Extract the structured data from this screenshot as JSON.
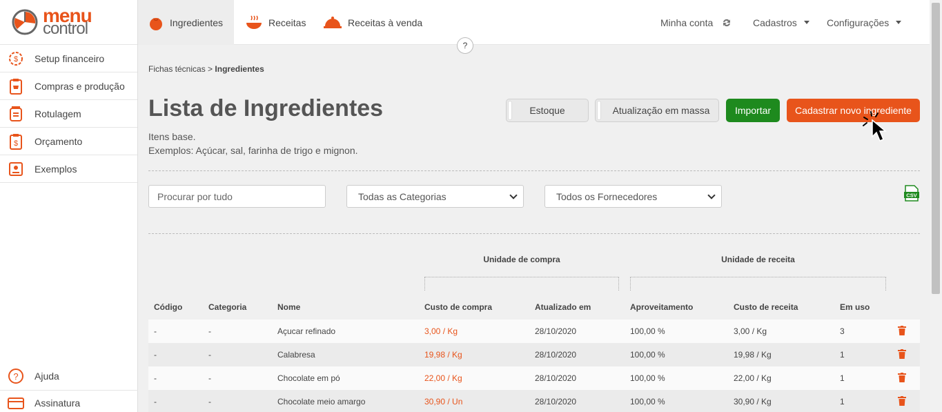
{
  "logo": {
    "line1": "menu",
    "line2": "control"
  },
  "sidebar": {
    "items": [
      {
        "label": "Setup financeiro",
        "icon": "gear-dollar-icon"
      },
      {
        "label": "Compras e produção",
        "icon": "cart-clipboard-icon"
      },
      {
        "label": "Rotulagem",
        "icon": "label-jar-icon"
      },
      {
        "label": "Orçamento",
        "icon": "dollar-clipboard-icon"
      },
      {
        "label": "Exemplos",
        "icon": "recipe-book-icon"
      }
    ],
    "bottom": [
      {
        "label": "Ajuda",
        "icon": "question-circle-icon"
      },
      {
        "label": "Assinatura",
        "icon": "credit-card-icon"
      }
    ]
  },
  "topnav": {
    "tabs": [
      {
        "label": "Ingredientes",
        "icon": "tomato-icon"
      },
      {
        "label": "Receitas",
        "icon": "steaming-bowl-icon"
      },
      {
        "label": "Receitas à venda",
        "icon": "cloche-icon"
      }
    ],
    "account": "Minha conta",
    "cadastros": "Cadastros",
    "configuracoes": "Configurações",
    "help": "?"
  },
  "breadcrumb": {
    "parent": "Fichas técnicas",
    "separator": ">",
    "current": "Ingredientes"
  },
  "page": {
    "title": "Lista de Ingredientes",
    "subtitle1": "Itens base.",
    "subtitle2": "Exemplos: Açúcar, sal, farinha de trigo e mignon."
  },
  "actions": {
    "estoque": "Estoque",
    "mass_update": "Atualização em massa",
    "import": "Importar",
    "new": "Cadastrar novo ingrediente"
  },
  "filters": {
    "search_placeholder": "Procurar por tudo",
    "category": "Todas as Categorias",
    "supplier": "Todos os Fornecedores",
    "csv": "CSV"
  },
  "table": {
    "group_purchase": "Unidade de compra",
    "group_recipe": "Unidade de receita",
    "headers": {
      "code": "Código",
      "category": "Categoria",
      "name": "Nome",
      "purchase_cost": "Custo de compra",
      "updated": "Atualizado em",
      "yield": "Aproveitamento",
      "recipe_cost": "Custo de receita",
      "in_use": "Em uso"
    },
    "rows": [
      {
        "code": "-",
        "category": "-",
        "name": "Açucar refinado",
        "purchase_cost": "3,00 / Kg",
        "updated": "28/10/2020",
        "yield": "100,00 %",
        "recipe_cost": "3,00 / Kg",
        "in_use": "3"
      },
      {
        "code": "-",
        "category": "-",
        "name": "Calabresa",
        "purchase_cost": "19,98 / Kg",
        "updated": "28/10/2020",
        "yield": "100,00 %",
        "recipe_cost": "19,98 / Kg",
        "in_use": "1"
      },
      {
        "code": "-",
        "category": "-",
        "name": "Chocolate em pó",
        "purchase_cost": "22,00 / Kg",
        "updated": "28/10/2020",
        "yield": "100,00 %",
        "recipe_cost": "22,00 / Kg",
        "in_use": "1"
      },
      {
        "code": "-",
        "category": "-",
        "name": "Chocolate meio amargo",
        "purchase_cost": "30,90 / Un",
        "updated": "28/10/2020",
        "yield": "100,00 %",
        "recipe_cost": "30,90 / Kg",
        "in_use": "1"
      }
    ]
  },
  "colors": {
    "brand_orange": "#e8541b",
    "green": "#1e8a1e"
  }
}
